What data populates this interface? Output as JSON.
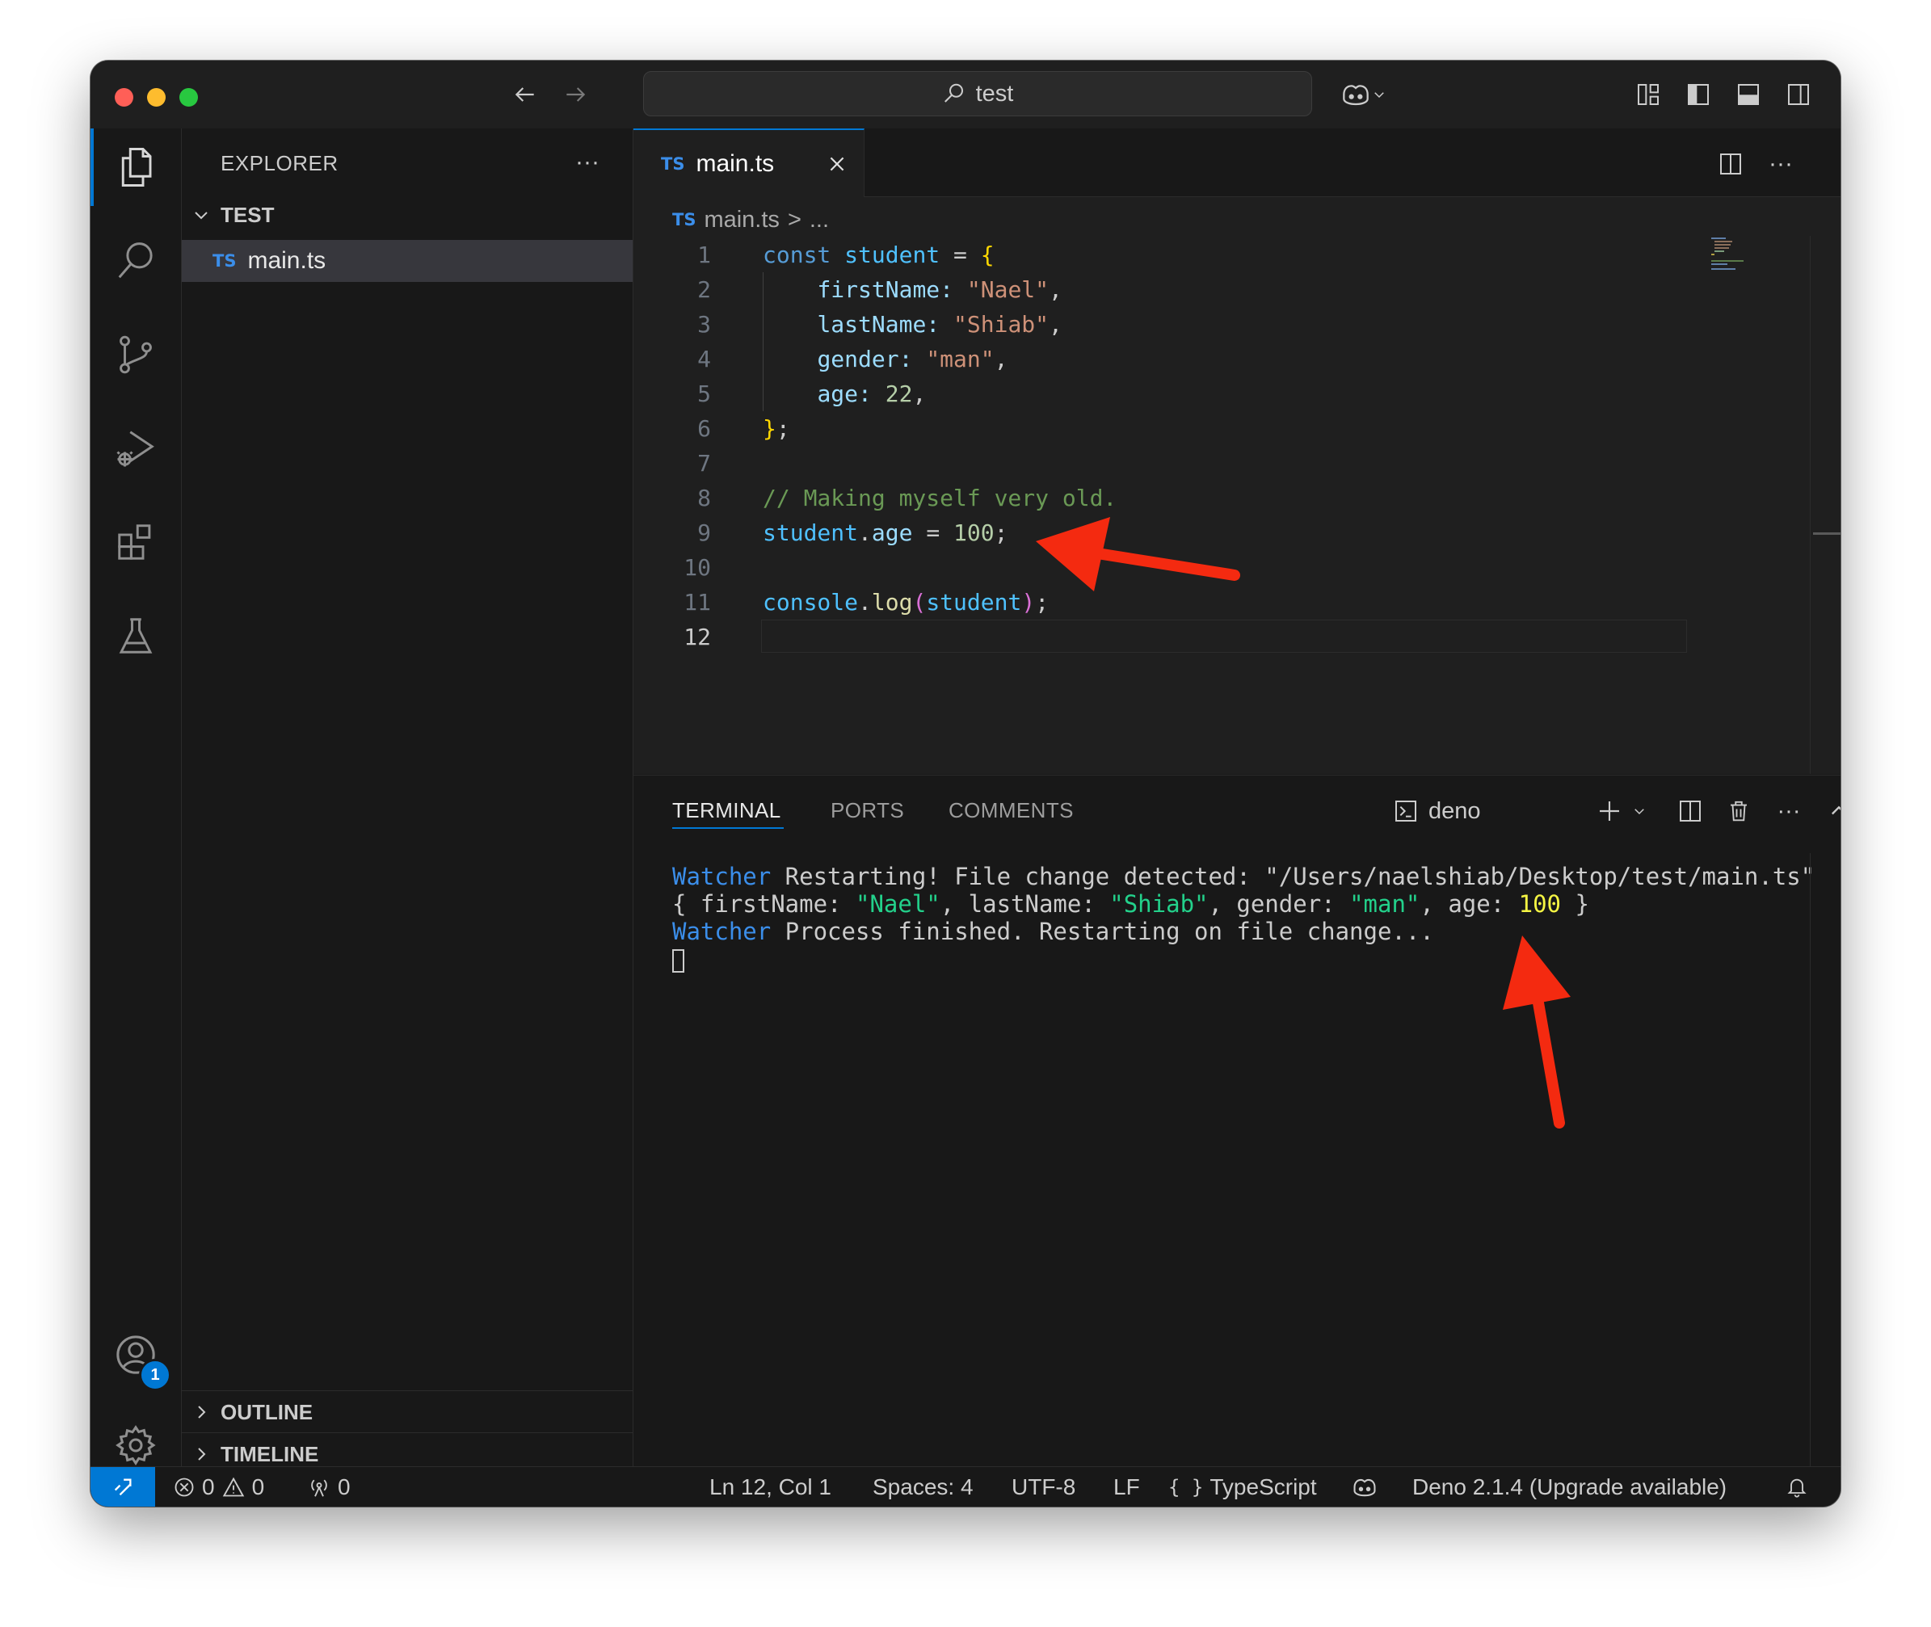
{
  "titlebar": {
    "search_text": "test"
  },
  "sidebar": {
    "title": "EXPLORER",
    "more": "···",
    "folder": "TEST",
    "files": [
      {
        "badge": "TS",
        "name": "main.ts"
      }
    ],
    "outline": "OUTLINE",
    "timeline": "TIMELINE"
  },
  "accounts_badge": "1",
  "editor": {
    "tab": {
      "badge": "TS",
      "name": "main.ts"
    },
    "more": "···",
    "breadcrumb": {
      "badge": "TS",
      "file": "main.ts",
      "sep": ">",
      "rest": "..."
    },
    "line_numbers": [
      "1",
      "2",
      "3",
      "4",
      "5",
      "6",
      "7",
      "8",
      "9",
      "10",
      "11",
      "12"
    ],
    "current_line": 12,
    "code": {
      "l1": [
        "const",
        "student",
        "=",
        "{"
      ],
      "l2": [
        "firstName:",
        "\"Nael\"",
        ","
      ],
      "l3": [
        "lastName:",
        "\"Shiab\"",
        ","
      ],
      "l4": [
        "gender:",
        "\"man\"",
        ","
      ],
      "l5": [
        "age:",
        "22",
        ","
      ],
      "l6": [
        "}",
        ";"
      ],
      "l8": "// Making myself very old.",
      "l9": [
        "student",
        ".",
        "age",
        "=",
        "100",
        ";"
      ],
      "l11": [
        "console",
        ".",
        "log",
        "(",
        "student",
        ")",
        ";"
      ]
    }
  },
  "panel": {
    "tabs": [
      "TERMINAL",
      "PORTS",
      "COMMENTS"
    ],
    "active_tab": "TERMINAL",
    "terminal_name": "deno",
    "more": "···",
    "output": {
      "line1": {
        "tag": "Watcher",
        "text": " Restarting! File change detected: \"/Users/naelshiab/Desktop/test/main.ts\""
      },
      "line2": {
        "open": "{ firstName: ",
        "first": "\"Nael\"",
        "mid1": ", lastName: ",
        "last": "\"Shiab\"",
        "mid2": ", gender: ",
        "gender": "\"man\"",
        "mid3": ", age: ",
        "age": "100",
        "close": " }"
      },
      "line3": {
        "tag": "Watcher",
        "text": " Process finished. Restarting on file change..."
      }
    }
  },
  "statusbar": {
    "errors": "0",
    "warnings": "0",
    "ports": "0",
    "position": "Ln 12, Col 1",
    "spaces": "Spaces: 4",
    "encoding": "UTF-8",
    "eol": "LF",
    "language_icon": "{ }",
    "language": "TypeScript",
    "runtime": "Deno 2.1.4 (Upgrade available)"
  },
  "colors": {
    "accent": "#0078d4",
    "annotation_arrow": "#f42a10",
    "keyword": "#569cd6",
    "string": "#ce9178",
    "number": "#b5cea8",
    "comment": "#6a9955"
  }
}
